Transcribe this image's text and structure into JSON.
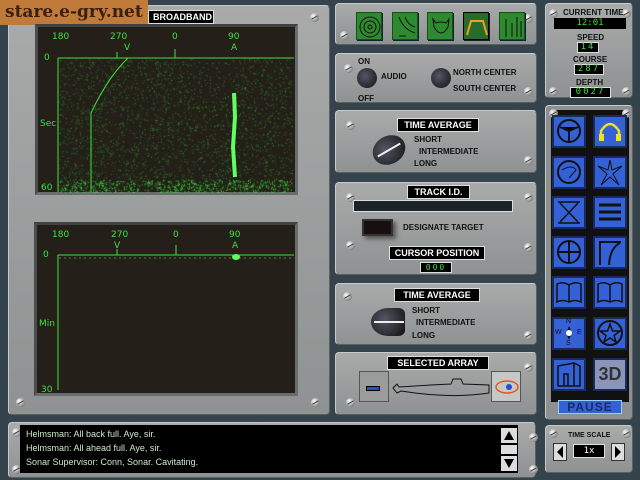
{
  "watermark": "stare.e-gry.net",
  "broadband": {
    "title": "BROADBAND",
    "bearings": [
      "180",
      "270",
      "0",
      "90"
    ],
    "markers": [
      "V",
      "A"
    ],
    "y_labels": [
      "0",
      "Sec",
      "60"
    ]
  },
  "narrowband": {
    "bearings": [
      "180",
      "270",
      "0",
      "90"
    ],
    "markers": [
      "V",
      "A"
    ],
    "y_labels": [
      "0",
      "Min",
      "30"
    ]
  },
  "toolbar": {
    "icons": [
      "sonar-rings-icon",
      "sonar-wave-icon",
      "devil-icon",
      "broadband-icon",
      "waterfall-bars-icon"
    ]
  },
  "audio": {
    "on": "ON",
    "off": "OFF",
    "label": "AUDIO",
    "north": "NORTH CENTER",
    "south": "SOUTH CENTER"
  },
  "time_average_1": {
    "title": "TIME AVERAGE",
    "options": [
      "SHORT",
      "INTERMEDIATE",
      "LONG"
    ]
  },
  "track": {
    "title": "TRACK I.D.",
    "id_value": "",
    "designate": "DESIGNATE TARGET",
    "cursor_title": "CURSOR POSITION",
    "cursor_value": "000"
  },
  "time_average_2": {
    "title": "TIME AVERAGE",
    "options": [
      "SHORT",
      "INTERMEDIATE",
      "LONG"
    ]
  },
  "array": {
    "title": "SELECTED ARRAY"
  },
  "status": {
    "time_label": "CURRENT TIME",
    "time": "12:01",
    "speed_label": "SPEED",
    "speed": "14",
    "course_label": "COURSE",
    "course": "287",
    "depth_label": "DEPTH",
    "depth": "0027"
  },
  "nav": {
    "pause": "PAUSE",
    "three_d": "3D",
    "compass": [
      "N",
      "E",
      "S",
      "W"
    ]
  },
  "messages": [
    "Helmsman:  All back full.  Aye, sir.",
    "Helmsman:  All ahead full.  Aye, sir.",
    "Sonar Supervisor:  Conn, Sonar.  Cavitating."
  ],
  "time_scale": {
    "label": "TIME SCALE",
    "value": "1x"
  }
}
